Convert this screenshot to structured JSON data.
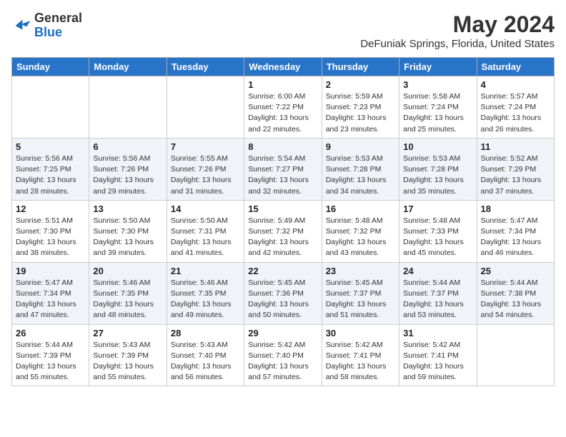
{
  "header": {
    "logo_general": "General",
    "logo_blue": "Blue",
    "month": "May 2024",
    "location": "DeFuniak Springs, Florida, United States"
  },
  "weekdays": [
    "Sunday",
    "Monday",
    "Tuesday",
    "Wednesday",
    "Thursday",
    "Friday",
    "Saturday"
  ],
  "weeks": [
    [
      {
        "day": "",
        "sunrise": "",
        "sunset": "",
        "daylight": "",
        "empty": true
      },
      {
        "day": "",
        "sunrise": "",
        "sunset": "",
        "daylight": "",
        "empty": true
      },
      {
        "day": "",
        "sunrise": "",
        "sunset": "",
        "daylight": "",
        "empty": true
      },
      {
        "day": "1",
        "sunrise": "Sunrise: 6:00 AM",
        "sunset": "Sunset: 7:22 PM",
        "daylight": "Daylight: 13 hours and 22 minutes."
      },
      {
        "day": "2",
        "sunrise": "Sunrise: 5:59 AM",
        "sunset": "Sunset: 7:23 PM",
        "daylight": "Daylight: 13 hours and 23 minutes."
      },
      {
        "day": "3",
        "sunrise": "Sunrise: 5:58 AM",
        "sunset": "Sunset: 7:24 PM",
        "daylight": "Daylight: 13 hours and 25 minutes."
      },
      {
        "day": "4",
        "sunrise": "Sunrise: 5:57 AM",
        "sunset": "Sunset: 7:24 PM",
        "daylight": "Daylight: 13 hours and 26 minutes."
      }
    ],
    [
      {
        "day": "5",
        "sunrise": "Sunrise: 5:56 AM",
        "sunset": "Sunset: 7:25 PM",
        "daylight": "Daylight: 13 hours and 28 minutes."
      },
      {
        "day": "6",
        "sunrise": "Sunrise: 5:56 AM",
        "sunset": "Sunset: 7:26 PM",
        "daylight": "Daylight: 13 hours and 29 minutes."
      },
      {
        "day": "7",
        "sunrise": "Sunrise: 5:55 AM",
        "sunset": "Sunset: 7:26 PM",
        "daylight": "Daylight: 13 hours and 31 minutes."
      },
      {
        "day": "8",
        "sunrise": "Sunrise: 5:54 AM",
        "sunset": "Sunset: 7:27 PM",
        "daylight": "Daylight: 13 hours and 32 minutes."
      },
      {
        "day": "9",
        "sunrise": "Sunrise: 5:53 AM",
        "sunset": "Sunset: 7:28 PM",
        "daylight": "Daylight: 13 hours and 34 minutes."
      },
      {
        "day": "10",
        "sunrise": "Sunrise: 5:53 AM",
        "sunset": "Sunset: 7:28 PM",
        "daylight": "Daylight: 13 hours and 35 minutes."
      },
      {
        "day": "11",
        "sunrise": "Sunrise: 5:52 AM",
        "sunset": "Sunset: 7:29 PM",
        "daylight": "Daylight: 13 hours and 37 minutes."
      }
    ],
    [
      {
        "day": "12",
        "sunrise": "Sunrise: 5:51 AM",
        "sunset": "Sunset: 7:30 PM",
        "daylight": "Daylight: 13 hours and 38 minutes."
      },
      {
        "day": "13",
        "sunrise": "Sunrise: 5:50 AM",
        "sunset": "Sunset: 7:30 PM",
        "daylight": "Daylight: 13 hours and 39 minutes."
      },
      {
        "day": "14",
        "sunrise": "Sunrise: 5:50 AM",
        "sunset": "Sunset: 7:31 PM",
        "daylight": "Daylight: 13 hours and 41 minutes."
      },
      {
        "day": "15",
        "sunrise": "Sunrise: 5:49 AM",
        "sunset": "Sunset: 7:32 PM",
        "daylight": "Daylight: 13 hours and 42 minutes."
      },
      {
        "day": "16",
        "sunrise": "Sunrise: 5:48 AM",
        "sunset": "Sunset: 7:32 PM",
        "daylight": "Daylight: 13 hours and 43 minutes."
      },
      {
        "day": "17",
        "sunrise": "Sunrise: 5:48 AM",
        "sunset": "Sunset: 7:33 PM",
        "daylight": "Daylight: 13 hours and 45 minutes."
      },
      {
        "day": "18",
        "sunrise": "Sunrise: 5:47 AM",
        "sunset": "Sunset: 7:34 PM",
        "daylight": "Daylight: 13 hours and 46 minutes."
      }
    ],
    [
      {
        "day": "19",
        "sunrise": "Sunrise: 5:47 AM",
        "sunset": "Sunset: 7:34 PM",
        "daylight": "Daylight: 13 hours and 47 minutes."
      },
      {
        "day": "20",
        "sunrise": "Sunrise: 5:46 AM",
        "sunset": "Sunset: 7:35 PM",
        "daylight": "Daylight: 13 hours and 48 minutes."
      },
      {
        "day": "21",
        "sunrise": "Sunrise: 5:46 AM",
        "sunset": "Sunset: 7:35 PM",
        "daylight": "Daylight: 13 hours and 49 minutes."
      },
      {
        "day": "22",
        "sunrise": "Sunrise: 5:45 AM",
        "sunset": "Sunset: 7:36 PM",
        "daylight": "Daylight: 13 hours and 50 minutes."
      },
      {
        "day": "23",
        "sunrise": "Sunrise: 5:45 AM",
        "sunset": "Sunset: 7:37 PM",
        "daylight": "Daylight: 13 hours and 51 minutes."
      },
      {
        "day": "24",
        "sunrise": "Sunrise: 5:44 AM",
        "sunset": "Sunset: 7:37 PM",
        "daylight": "Daylight: 13 hours and 53 minutes."
      },
      {
        "day": "25",
        "sunrise": "Sunrise: 5:44 AM",
        "sunset": "Sunset: 7:38 PM",
        "daylight": "Daylight: 13 hours and 54 minutes."
      }
    ],
    [
      {
        "day": "26",
        "sunrise": "Sunrise: 5:44 AM",
        "sunset": "Sunset: 7:39 PM",
        "daylight": "Daylight: 13 hours and 55 minutes."
      },
      {
        "day": "27",
        "sunrise": "Sunrise: 5:43 AM",
        "sunset": "Sunset: 7:39 PM",
        "daylight": "Daylight: 13 hours and 55 minutes."
      },
      {
        "day": "28",
        "sunrise": "Sunrise: 5:43 AM",
        "sunset": "Sunset: 7:40 PM",
        "daylight": "Daylight: 13 hours and 56 minutes."
      },
      {
        "day": "29",
        "sunrise": "Sunrise: 5:42 AM",
        "sunset": "Sunset: 7:40 PM",
        "daylight": "Daylight: 13 hours and 57 minutes."
      },
      {
        "day": "30",
        "sunrise": "Sunrise: 5:42 AM",
        "sunset": "Sunset: 7:41 PM",
        "daylight": "Daylight: 13 hours and 58 minutes."
      },
      {
        "day": "31",
        "sunrise": "Sunrise: 5:42 AM",
        "sunset": "Sunset: 7:41 PM",
        "daylight": "Daylight: 13 hours and 59 minutes."
      },
      {
        "day": "",
        "sunrise": "",
        "sunset": "",
        "daylight": "",
        "empty": true
      }
    ]
  ]
}
